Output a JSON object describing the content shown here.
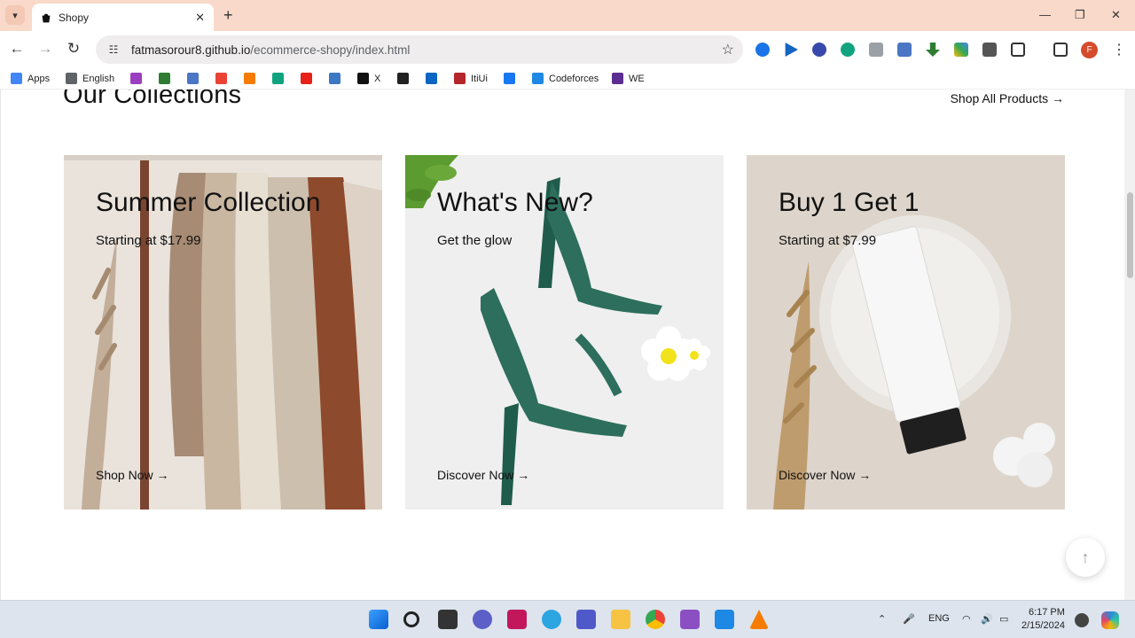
{
  "browser": {
    "tab": {
      "title": "Shopy"
    },
    "url_host": "fatmasorour8.github.io",
    "url_path": "/ecommerce-shopy/index.html",
    "bookmarks": [
      {
        "label": "Apps",
        "color": "#4285f4"
      },
      {
        "label": "English",
        "color": "#5f6368"
      },
      {
        "label": "",
        "color": "#9b3fc1"
      },
      {
        "label": "",
        "color": "#2e7d32"
      },
      {
        "label": "",
        "color": "#4a76c5"
      },
      {
        "label": "",
        "color": "#ea4335"
      },
      {
        "label": "",
        "color": "#f57c00"
      },
      {
        "label": "",
        "color": "#10a37f"
      },
      {
        "label": "",
        "color": "#e62117"
      },
      {
        "label": "",
        "color": "#3c78c3"
      },
      {
        "label": "X",
        "color": "#111111"
      },
      {
        "label": "",
        "color": "#222222"
      },
      {
        "label": "",
        "color": "#0a66c2"
      },
      {
        "label": "ItiUi",
        "color": "#b5252c"
      },
      {
        "label": "",
        "color": "#1877f2"
      },
      {
        "label": "Codeforces",
        "color": "#1e88e5"
      },
      {
        "label": "WE",
        "color": "#5c2d91"
      }
    ]
  },
  "page": {
    "section_title": "Our Collections",
    "shop_all": "Shop All Products →",
    "cards": [
      {
        "heading": "Summer Collection",
        "sub": "Starting at $17.99",
        "cta": "Shop Now →"
      },
      {
        "heading": "What's New?",
        "sub": "Get the glow",
        "cta": "Discover Now →"
      },
      {
        "heading": "Buy 1 Get 1",
        "sub": "Starting at $7.99",
        "cta": "Discover Now →"
      }
    ],
    "back_to_top": "↑"
  },
  "taskbar": {
    "language": "ENG",
    "time": "6:17 PM",
    "date": "2/15/2024"
  }
}
